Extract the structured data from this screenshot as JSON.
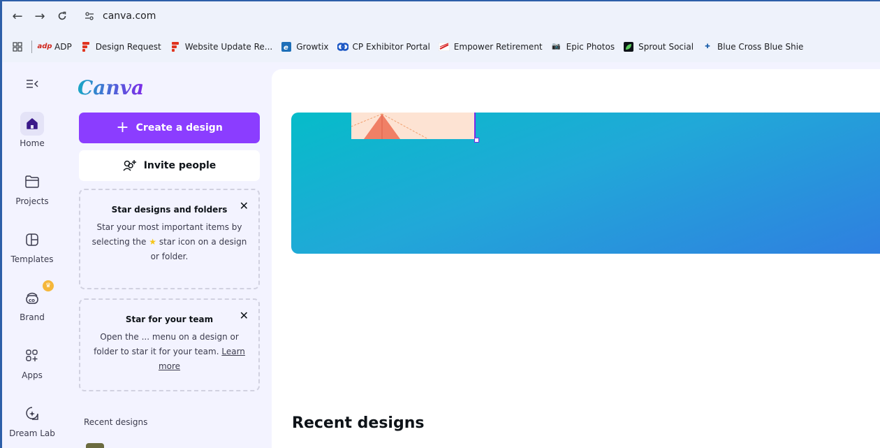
{
  "browser": {
    "url": "canva.com",
    "bookmarks": [
      {
        "label": "ADP",
        "icon": "adp-icon",
        "color": "#d0271d"
      },
      {
        "label": "Design Request",
        "icon": "form-icon",
        "color": "#e0341f"
      },
      {
        "label": "Website Update Re...",
        "icon": "form-icon",
        "color": "#e0341f"
      },
      {
        "label": "Growtix",
        "icon": "growtix-icon",
        "color": "#1d6fb8"
      },
      {
        "label": "CP Exhibitor Portal",
        "icon": "cp-icon",
        "color": "#1a56c4"
      },
      {
        "label": "Empower Retirement",
        "icon": "empower-icon",
        "color": "#d62020"
      },
      {
        "label": "Epic Photos",
        "icon": "camera-icon",
        "color": "#5f6368"
      },
      {
        "label": "Sprout Social",
        "icon": "sprout-icon",
        "color": "#2e9e4d"
      },
      {
        "label": "Blue Cross Blue Shie",
        "icon": "bcbs-icon",
        "color": "#1b5faa"
      }
    ]
  },
  "rail": {
    "items": [
      {
        "label": "Home",
        "icon": "home-icon"
      },
      {
        "label": "Projects",
        "icon": "folder-icon"
      },
      {
        "label": "Templates",
        "icon": "templates-icon"
      },
      {
        "label": "Brand",
        "icon": "brand-icon"
      },
      {
        "label": "Apps",
        "icon": "apps-icon"
      },
      {
        "label": "Dream Lab",
        "icon": "dream-lab-icon"
      }
    ]
  },
  "panel": {
    "logo": "Canva",
    "create_label": "Create a design",
    "invite_label": "Invite people",
    "card1": {
      "title": "Star designs and folders",
      "line1": "Star your most important items by",
      "line2a": "selecting the",
      "line2b": "star icon on a design",
      "line3": "or folder."
    },
    "card2": {
      "title": "Star for your team",
      "line1": "Open the ... menu on a design or",
      "line2": "folder to star it for your team.",
      "link1": "Learn",
      "link2": "more"
    },
    "recent_label": "Recent designs"
  },
  "main": {
    "recent_title": "Recent designs"
  },
  "colors": {
    "brand_purple": "#8b3dff",
    "hero_start": "#06bcc9",
    "hero_end": "#2f7fe0"
  }
}
